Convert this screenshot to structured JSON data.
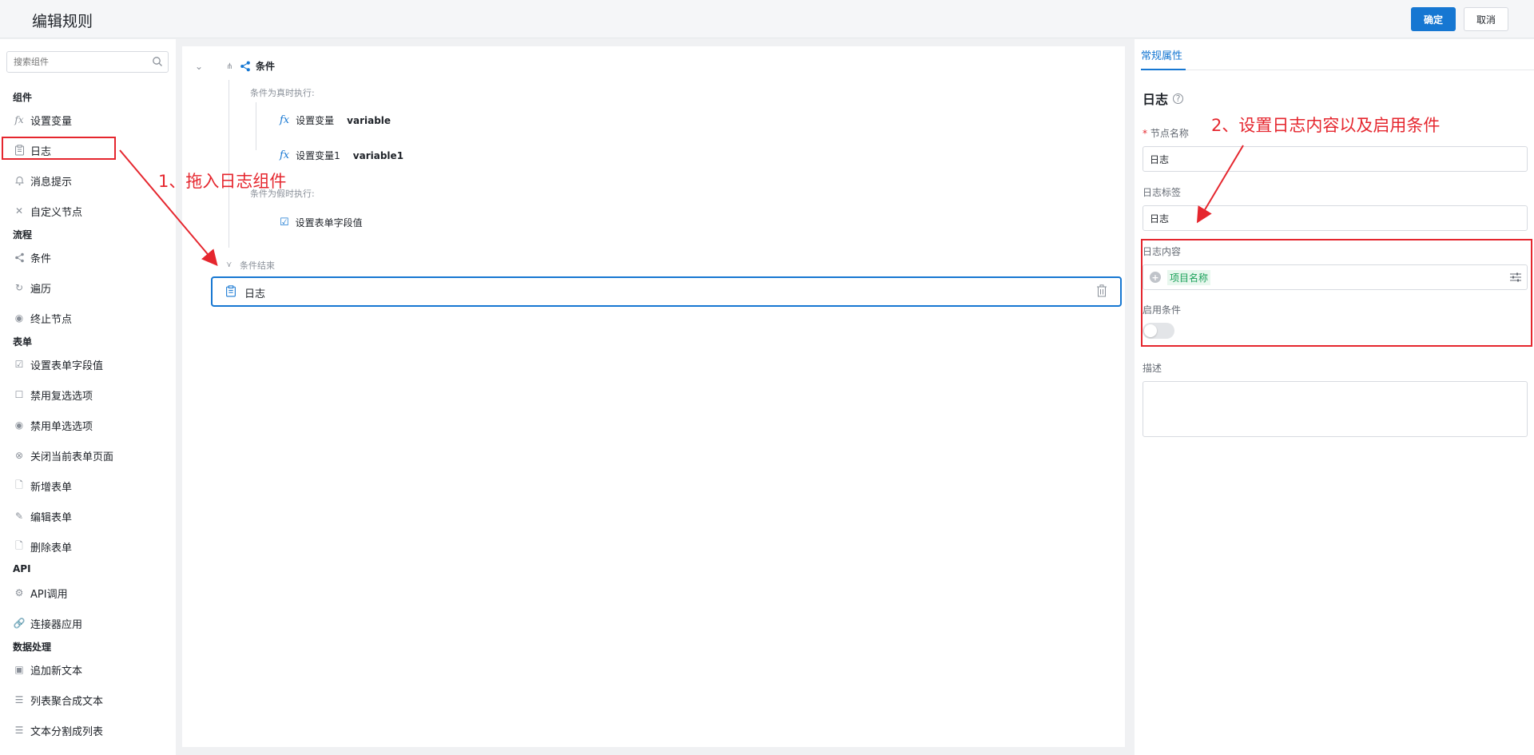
{
  "header": {
    "title": "编辑规则",
    "confirm_label": "确定",
    "cancel_label": "取消"
  },
  "sidebar": {
    "search_placeholder": "搜索组件",
    "sections": {
      "components": "组件",
      "flow": "流程",
      "form": "表单",
      "api": "API",
      "data": "数据处理"
    },
    "items": {
      "set_var": "设置变量",
      "log": "日志",
      "message": "消息提示",
      "custom_node": "自定义节点",
      "condition": "条件",
      "loop": "遍历",
      "stop_node": "终止节点",
      "set_form_field": "设置表单字段值",
      "disable_checkbox": "禁用复选选项",
      "disable_radio": "禁用单选选项",
      "close_form_page": "关闭当前表单页面",
      "add_form": "新增表单",
      "edit_form": "编辑表单",
      "delete_form": "删除表单",
      "api_call": "API调用",
      "connector_app": "连接器应用",
      "append_text": "追加新文本",
      "list_to_text": "列表聚合成文本",
      "text_to_list": "文本分割成列表"
    }
  },
  "canvas": {
    "condition_label": "条件",
    "true_caption": "条件为真时执行:",
    "set_var_1": "设置变量",
    "set_var_1_value": "variable",
    "set_var_2": "设置变量1",
    "set_var_2_value": "variable1",
    "false_caption": "条件为假时执行:",
    "set_form_field": "设置表单字段值",
    "condition_end": "条件结束",
    "log_node": "日志"
  },
  "right_panel": {
    "tab": "常规属性",
    "title": "日志",
    "node_name_label": "节点名称",
    "node_name_value": "日志",
    "log_tag_label": "日志标签",
    "log_tag_value": "日志",
    "log_content_label": "日志内容",
    "log_content_tag": "项目名称",
    "enable_condition_label": "启用条件",
    "enable_condition_on": false,
    "description_label": "描述"
  },
  "annotations": {
    "step1": "1、拖入日志组件",
    "step2": "2、设置日志内容以及启用条件"
  },
  "colors": {
    "accent": "#1677d2",
    "annotation": "#e5262e",
    "tag_green": "#18a058"
  }
}
